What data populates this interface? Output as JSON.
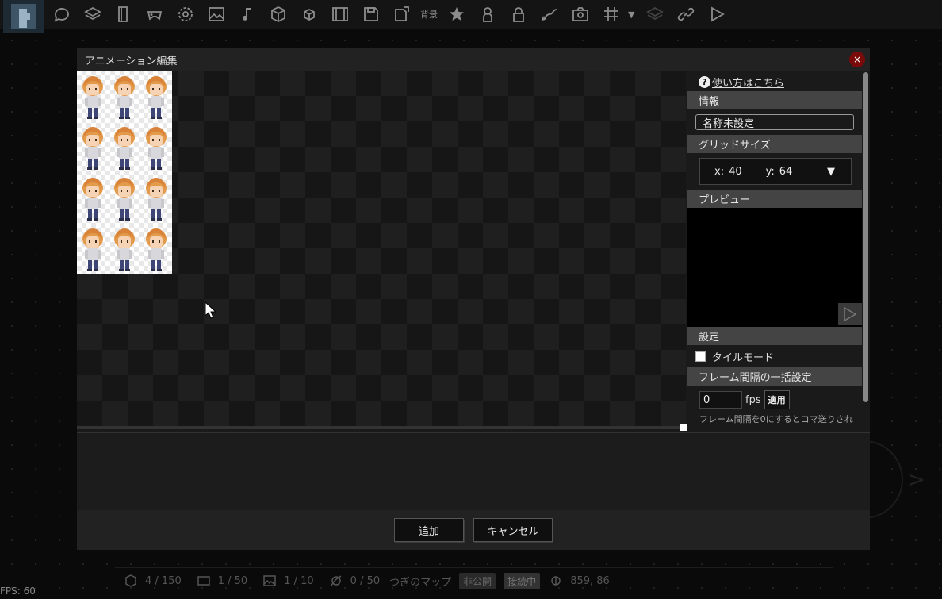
{
  "toolbar": {
    "icons": [
      "app-logo",
      "chat-icon",
      "layers-icon",
      "book-icon",
      "gamepad-icon",
      "gear-icon",
      "image-icon",
      "music-note-icon",
      "cube-icon",
      "small-cube-icon",
      "film-icon",
      "save-icon",
      "export-icon",
      "background-text",
      "star-icon",
      "person-icon",
      "lock-icon",
      "curve-icon",
      "camera-icon",
      "grid-icon",
      "dropdown-caret",
      "stack-icon",
      "link-icon",
      "play-icon"
    ],
    "background_label": "背景"
  },
  "dialog": {
    "title": "アニメーション編集",
    "close_label": "×"
  },
  "side_panel": {
    "help_icon": "?",
    "help_link": "使い方はこちら",
    "info_header": "情報",
    "name_value": "名称未設定",
    "grid_header": "グリッドサイズ",
    "grid_x_label": "x:",
    "grid_x_value": "40",
    "grid_y_label": "y:",
    "grid_y_value": "64",
    "grid_caret": "▼",
    "preview_header": "プレビュー",
    "settings_header": "設定",
    "tile_mode_label": "タイルモード",
    "tile_mode_checked": false,
    "frame_interval_header": "フレーム間隔の一括設定",
    "fps_value": "0",
    "fps_unit": "fps",
    "apply_label": "適用",
    "note": "フレーム間隔を0にするとコマ送りされ"
  },
  "footer": {
    "add_label": "追加",
    "cancel_label": "キャンセル"
  },
  "statusbar": {
    "objects": "4 / 150",
    "frames": "1 / 50",
    "images": "1 / 10",
    "paths": "0 / 50",
    "next_map": "つぎのマップ",
    "private_badge": "非公開",
    "connecting_badge": "接続中",
    "coordinates": "859, 86"
  },
  "fps_counter": "FPS: 60",
  "colors": {
    "close_button": "#7a0a0a",
    "section_header": "#444444",
    "dialog_bg": "#1a1a1a"
  }
}
